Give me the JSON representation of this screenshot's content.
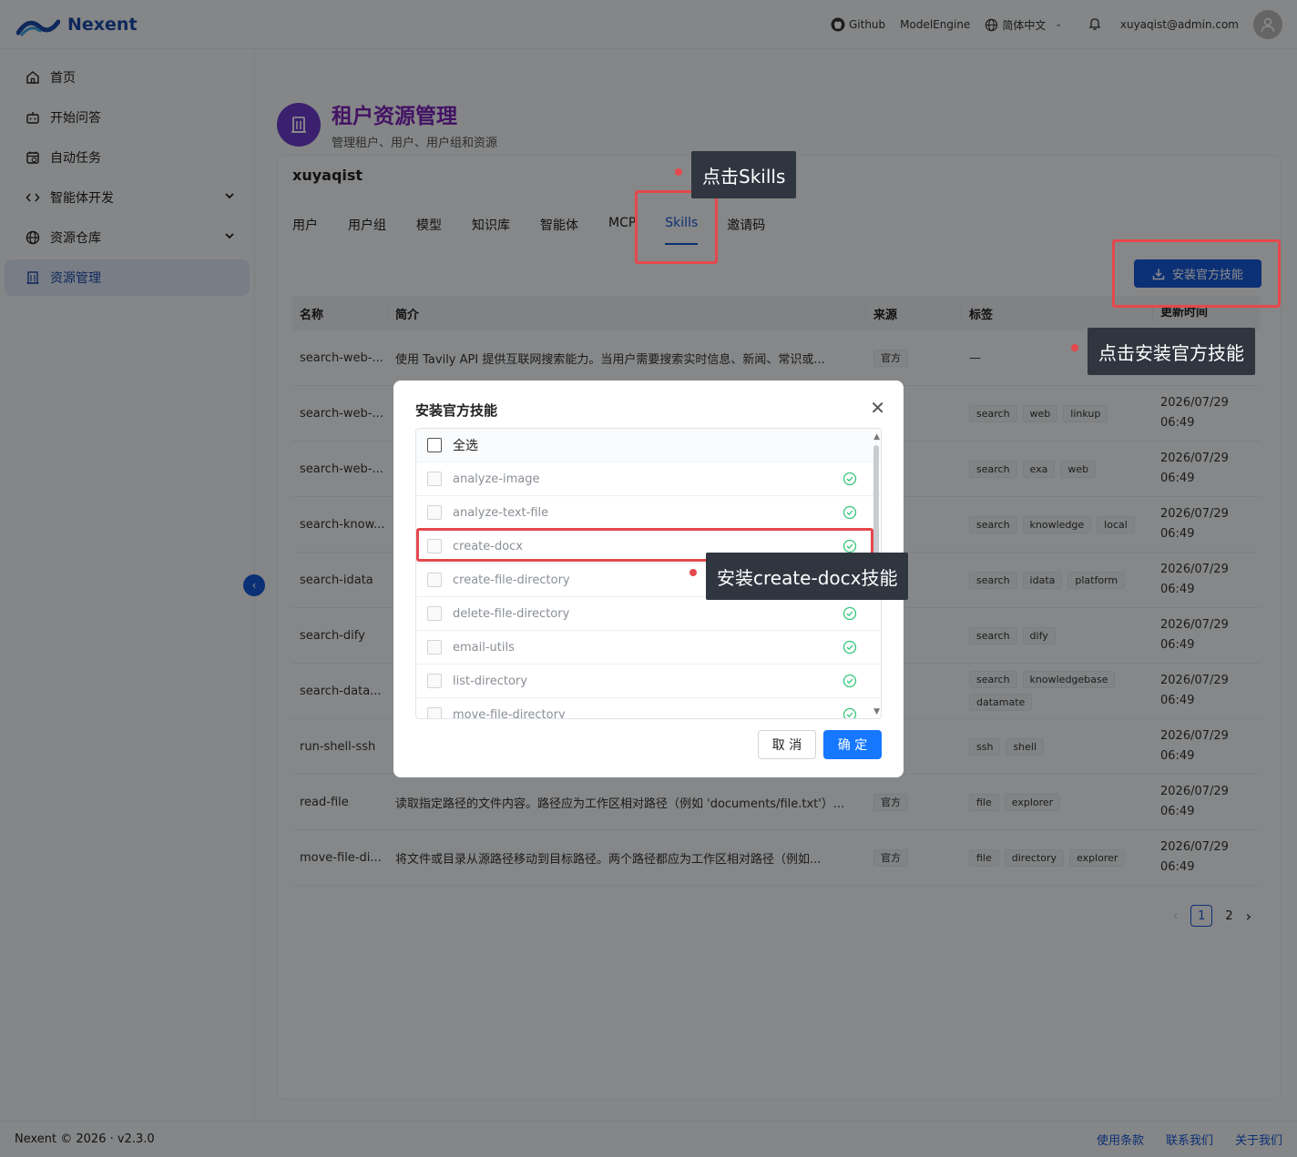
{
  "app": {
    "name": "Nexent"
  },
  "topbar": {
    "github": "Github",
    "model_engine": "ModelEngine",
    "language": "简体中文",
    "user_email": "xuyaqist@admin.com"
  },
  "sidebar": {
    "items": [
      {
        "label": "首页",
        "icon": "home-icon"
      },
      {
        "label": "开始问答",
        "icon": "chat-icon"
      },
      {
        "label": "自动任务",
        "icon": "calendar-icon"
      },
      {
        "label": "智能体开发",
        "icon": "code-icon"
      },
      {
        "label": "资源仓库",
        "icon": "globe-icon"
      },
      {
        "label": "资源管理",
        "icon": "building-icon"
      }
    ]
  },
  "page": {
    "title": "租户资源管理",
    "subtitle": "管理租户、用户、用户组和资源",
    "tenant": "xuyaqist"
  },
  "tabs": [
    "用户",
    "用户组",
    "模型",
    "知识库",
    "智能体",
    "MCP",
    "Skills",
    "邀请码"
  ],
  "active_tab": "Skills",
  "install_button": "安装官方技能",
  "table": {
    "headers": [
      "名称",
      "简介",
      "来源",
      "标签",
      "更新时间"
    ],
    "rows": [
      {
        "name": "search-web-...",
        "desc": "使用 Tavily API 提供互联网搜索能力。当用户需要搜索实时信息、新闻、常识或...",
        "source": "官方",
        "tags": [],
        "time1": "",
        "time2": ""
      },
      {
        "name": "search-web-...",
        "desc": "",
        "source": "",
        "tags": [
          "search",
          "web",
          "linkup"
        ],
        "time1": "2026/07/29",
        "time2": "06:49"
      },
      {
        "name": "search-web-...",
        "desc": "",
        "source": "",
        "tags": [
          "search",
          "exa",
          "web"
        ],
        "time1": "2026/07/29",
        "time2": "06:49"
      },
      {
        "name": "search-know...",
        "desc": "",
        "source": "",
        "tags": [
          "search",
          "knowledge",
          "local"
        ],
        "time1": "2026/07/29",
        "time2": "06:49"
      },
      {
        "name": "search-idata",
        "desc": "",
        "source": "",
        "tags": [
          "search",
          "idata",
          "platform"
        ],
        "time1": "2026/07/29",
        "time2": "06:49"
      },
      {
        "name": "search-dify",
        "desc": "",
        "source": "",
        "tags": [
          "search",
          "dify"
        ],
        "time1": "2026/07/29",
        "time2": "06:49"
      },
      {
        "name": "search-data...",
        "desc": "",
        "source": "",
        "tags": [
          "search",
          "knowledgebase",
          "datamate"
        ],
        "time1": "2026/07/29",
        "time2": "06:49"
      },
      {
        "name": "run-shell-ssh",
        "desc": "",
        "source": "",
        "tags": [
          "ssh",
          "shell"
        ],
        "time1": "2026/07/29",
        "time2": "06:49"
      },
      {
        "name": "read-file",
        "desc": "读取指定路径的文件内容。路径应为工作区相对路径（例如 'documents/file.txt'）...",
        "source": "官方",
        "tags": [
          "file",
          "explorer"
        ],
        "time1": "2026/07/29",
        "time2": "06:49"
      },
      {
        "name": "move-file-di...",
        "desc": "将文件或目录从源路径移动到目标路径。两个路径都应为工作区相对路径（例如...",
        "source": "官方",
        "tags": [
          "file",
          "directory",
          "explorer"
        ],
        "time1": "2026/07/29",
        "time2": "06:49"
      }
    ],
    "empty_tag": "—"
  },
  "pagination": {
    "current": "1",
    "next_page": "2"
  },
  "footer": {
    "copyright": "Nexent © 2026 · v2.3.0",
    "links": [
      "使用条款",
      "联系我们",
      "关于我们"
    ]
  },
  "modal": {
    "title": "安装官方技能",
    "select_all": "全选",
    "items": [
      "analyze-image",
      "analyze-text-file",
      "create-docx",
      "create-file-directory",
      "delete-file-directory",
      "email-utils",
      "list-directory",
      "move-file-directory"
    ],
    "cancel": "取 消",
    "confirm": "确 定"
  },
  "annotations": {
    "skills": "点击Skills",
    "install": "点击安装官方技能",
    "create_docx": "安装create-docx技能"
  },
  "colors": {
    "accent": "#1758d6",
    "title": "#7a22b8",
    "annotation": "#e5484d"
  }
}
